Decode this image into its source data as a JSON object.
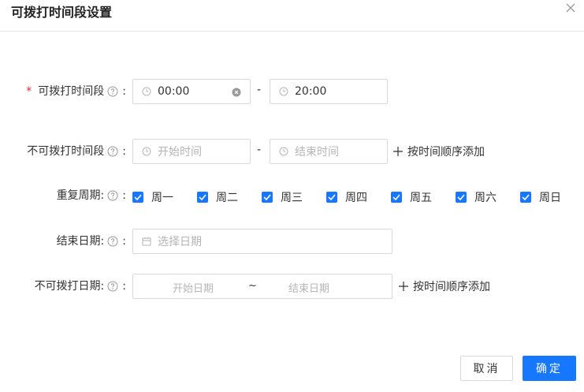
{
  "dialog": {
    "title": "可拨打时间段设置",
    "close_icon": "close-icon"
  },
  "form": {
    "callable_period": {
      "required_mark": "*",
      "label": "可拨打时间段",
      "colon": ":",
      "start_value": "00:00",
      "end_value": "20:00",
      "separator": "-"
    },
    "non_callable_period": {
      "label": "不可拨打时间段",
      "colon": ":",
      "start_placeholder": "开始时间",
      "end_placeholder": "结束时间",
      "separator": "-",
      "add_label": "按时间顺序添加"
    },
    "repeat": {
      "label": "重复周期:",
      "colon": ":",
      "days": [
        {
          "label": "周一",
          "checked": true
        },
        {
          "label": "周二",
          "checked": true
        },
        {
          "label": "周三",
          "checked": true
        },
        {
          "label": "周四",
          "checked": true
        },
        {
          "label": "周五",
          "checked": true
        },
        {
          "label": "周六",
          "checked": true
        },
        {
          "label": "周日",
          "checked": true
        }
      ]
    },
    "end_date": {
      "label": "结束日期:",
      "colon": ":",
      "placeholder": "选择日期"
    },
    "non_callable_date": {
      "label": "不可拨打日期:",
      "colon": ":",
      "start_placeholder": "开始日期",
      "end_placeholder": "结束日期",
      "separator": "~",
      "add_label": "按时间顺序添加"
    }
  },
  "footer": {
    "cancel_label": "取消",
    "ok_label": "确定"
  },
  "colors": {
    "primary": "#1677ff",
    "required": "#f5222d",
    "border": "#d9d9d9",
    "placeholder": "#b5b5b5"
  }
}
